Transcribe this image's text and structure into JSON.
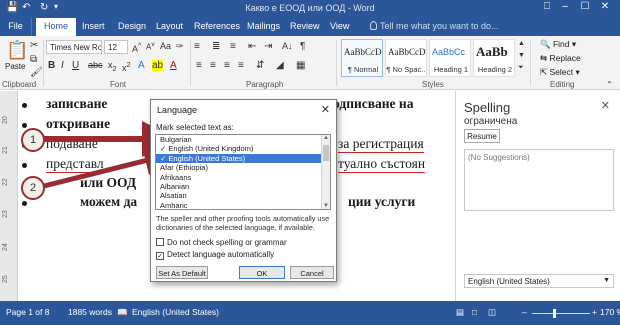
{
  "app": {
    "doc_title": "Какво е ЕООД или ООД - Word",
    "window_buttons": [
      "⎕",
      "–",
      "☐",
      "✕"
    ]
  },
  "quick_access": {
    "save_icon": "save-icon",
    "undo_icon": "undo-icon",
    "redo_icon": "redo-icon"
  },
  "tabs": [
    "File",
    "Home",
    "Insert",
    "Design",
    "Layout",
    "References",
    "Mailings",
    "Review",
    "View"
  ],
  "tell_me": "Tell me what you want to do...",
  "ribbon": {
    "clipboard": {
      "paste": "Paste",
      "label": "Clipboard"
    },
    "font": {
      "name": "Times New Ro",
      "size": "12",
      "label": "Font"
    },
    "paragraph": {
      "label": "Paragraph"
    },
    "styles": {
      "label": "Styles",
      "items": [
        {
          "sample": "AaBbCcDc",
          "name": "¶ Normal"
        },
        {
          "sample": "AaBbCcDc",
          "name": "¶ No Spac..."
        },
        {
          "sample": "AaBbCc",
          "name": "Heading 1"
        },
        {
          "sample": "AaBb",
          "name": "Heading 2"
        }
      ]
    },
    "editing": {
      "label": "Editing",
      "find": "Find",
      "replace": "Replace",
      "select": "Select"
    }
  },
  "ruler_numbers": [
    "20",
    "21",
    "22",
    "23",
    "24",
    "25"
  ],
  "document": {
    "lines": [
      {
        "left": "записване",
        "right": "одписване на",
        "right2": ""
      },
      {
        "left": "откриване",
        "right": "",
        "right2": ""
      },
      {
        "left": "подаване",
        "right": "за регистрация",
        "right2": ""
      },
      {
        "left": "представл",
        "right": "туално състоян",
        "right2": ""
      },
      {
        "left": "или ООД",
        "right": "",
        "right2": ""
      },
      {
        "left": "можем да",
        "right": "ции услуги",
        "right2": ""
      }
    ]
  },
  "dialog": {
    "title": "Language",
    "mark_label": "Mark selected text as:",
    "languages": [
      "Bulgarian",
      "English (United Kingdom)",
      "English (United States)",
      "Afar (Ethiopia)",
      "Afrikaans",
      "Albanian",
      "Alsatian",
      "Amharic"
    ],
    "selected_index": 2,
    "description": "The speller and other proofing tools automatically use dictionaries of the selected language, if available.",
    "checkbox_no_spell": "Do not check spelling or grammar",
    "checkbox_detect": "Detect language automatically",
    "set_default": "Set As Default",
    "ok": "OK",
    "cancel": "Cancel"
  },
  "spelling": {
    "title": "Spelling",
    "word": "ограничена",
    "resume": "Resume",
    "suggestions": "(No Suggestions)",
    "language": "English (United States)"
  },
  "callouts": [
    "1",
    "2"
  ],
  "status": {
    "page": "Page 1 of 8",
    "words": "1885 words",
    "language": "English (United States)",
    "zoom": "170 %"
  },
  "colors": {
    "word_blue": "#2b579a",
    "selection": "#3b79d4",
    "arrow_red": "#9a2b33"
  }
}
